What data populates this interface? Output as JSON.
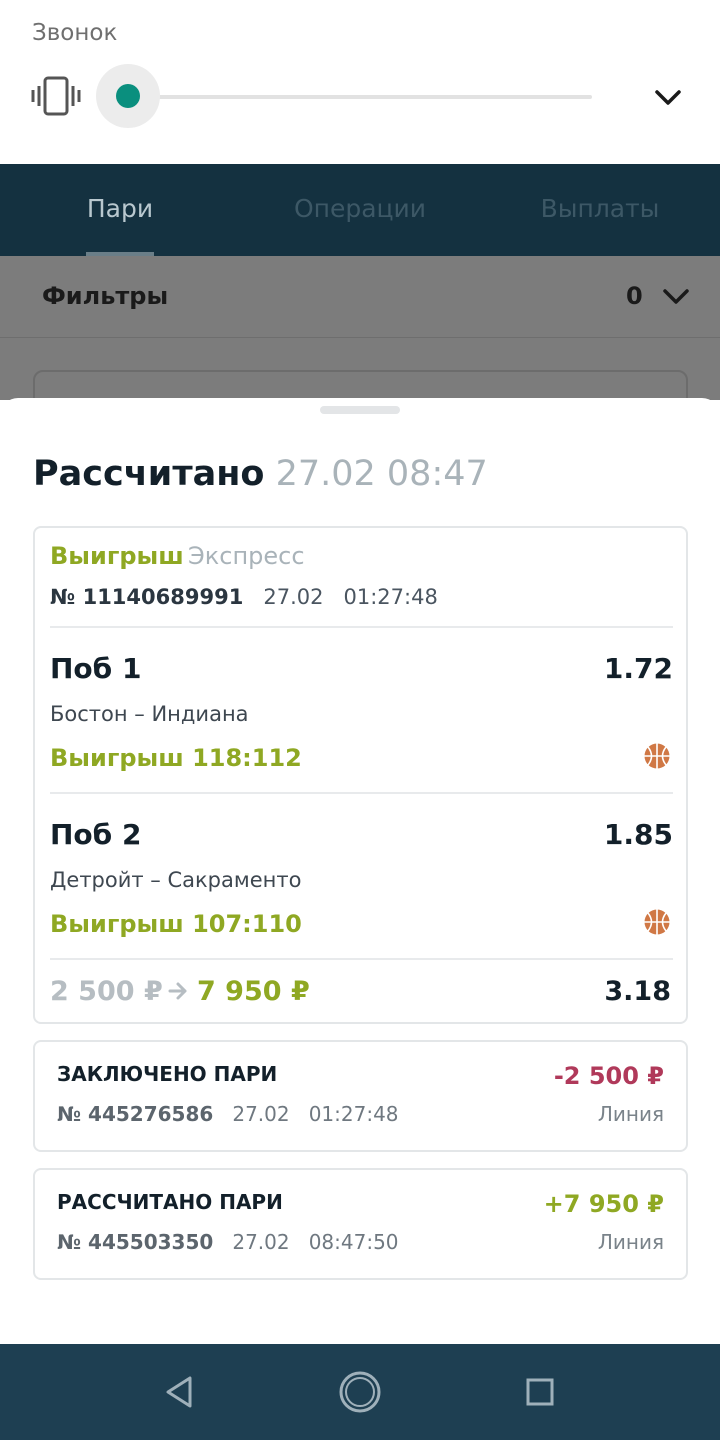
{
  "volume": {
    "title": "Звонок",
    "level": 0.0,
    "accent_color": "#0a8f7e",
    "icons": {
      "mode": "vibrate-icon",
      "expand": "chevron-down-icon"
    }
  },
  "tabs": [
    {
      "label": "Пари",
      "active": true
    },
    {
      "label": "Операции",
      "active": false
    },
    {
      "label": "Выплаты",
      "active": false
    }
  ],
  "filters": {
    "label": "Фильтры",
    "count": "0"
  },
  "sheet": {
    "status": "Рассчитано",
    "datetime": "27.02 08:47",
    "bet": {
      "status": "Выигрыш",
      "type": "Экспресс",
      "number": "№ 11140689991",
      "date": "27.02",
      "time": "01:27:48",
      "legs": [
        {
          "outcome": "Поб 1",
          "odds": "1.72",
          "match": "Бостон – Индиана",
          "result": "Выигрыш 118:112",
          "sport_icon": "basketball-icon"
        },
        {
          "outcome": "Поб 2",
          "odds": "1.85",
          "match": "Детройт – Сакраменто",
          "result": "Выигрыш 107:110",
          "sport_icon": "basketball-icon"
        }
      ],
      "stake": "2 500 ₽",
      "payout": "7 950 ₽",
      "total_odds": "3.18"
    },
    "operations": [
      {
        "title": "ЗАКЛЮЧЕНО ПАРИ",
        "amount": "-2 500 ₽",
        "amount_color": "#b0395a",
        "number": "№ 445276586",
        "date": "27.02",
        "time": "01:27:48",
        "line": "Линия"
      },
      {
        "title": "РАССЧИТАНО ПАРИ",
        "amount": "+7 950 ₽",
        "amount_color": "#8fa823",
        "number": "№ 445503350",
        "date": "27.02",
        "time": "08:47:50",
        "line": "Линия"
      }
    ]
  },
  "colors": {
    "win_green": "#8fa823",
    "loss_red": "#b0395a",
    "header_dark": "#143140",
    "navbar": "#1e3f52"
  },
  "navbar": {
    "icons": [
      "back-icon",
      "home-icon",
      "recents-icon"
    ]
  }
}
